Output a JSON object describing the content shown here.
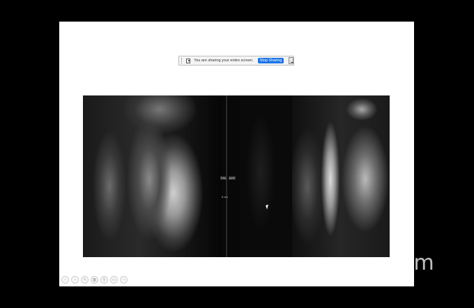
{
  "share_bar": {
    "message": "You are sharing your entire screen.",
    "stop_label": "Stop Sharing",
    "icons": [
      "drag-handle-icon",
      "screen-share-icon",
      "minimize-icon"
    ]
  },
  "mri": {
    "label_left": "PHL",
    "label_right": "AFR",
    "scale_label": "5 cm"
  },
  "watermark": "zoom",
  "slide_controls": [
    {
      "icon": "previous-slide-icon",
      "glyph": "‹"
    },
    {
      "icon": "next-slide-icon",
      "glyph": "›"
    },
    {
      "icon": "pen-icon",
      "glyph": "✎"
    },
    {
      "icon": "slides-grid-icon",
      "glyph": "▦"
    },
    {
      "icon": "magnify-icon",
      "glyph": "⚲"
    },
    {
      "icon": "subtitles-icon",
      "glyph": "▭"
    },
    {
      "icon": "more-options-icon",
      "glyph": "⋯"
    }
  ]
}
